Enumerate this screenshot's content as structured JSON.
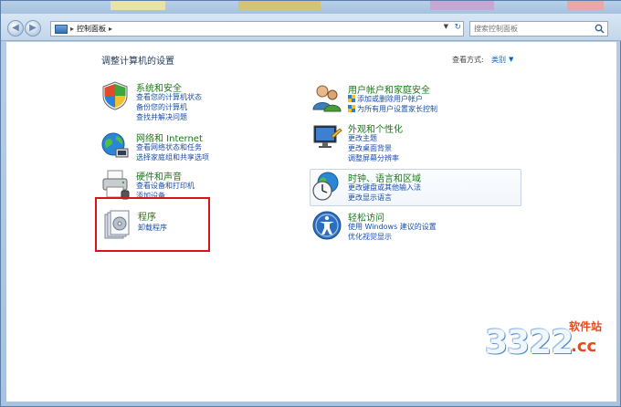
{
  "window": {
    "address": {
      "crumb": "控制面板"
    },
    "search": {
      "placeholder": "搜索控制面板"
    }
  },
  "page": {
    "title": "调整计算机的设置",
    "view_by_label": "查看方式:",
    "view_by_value": "类别"
  },
  "categories": [
    {
      "title": "系统和安全",
      "icon": "shield-icon",
      "links": [
        "查看您的计算机状态",
        "备份您的计算机",
        "查找并解决问题"
      ]
    },
    {
      "title": "网络和 Internet",
      "icon": "network-globe-icon",
      "links": [
        "查看网络状态和任务",
        "选择家庭组和共享选项"
      ]
    },
    {
      "title": "硬件和声音",
      "icon": "printer-icon",
      "links": [
        "查看设备和打印机",
        "添加设备"
      ]
    },
    {
      "title": "程序",
      "icon": "programs-icon",
      "links": [
        "卸载程序"
      ]
    },
    {
      "title": "用户帐户和家庭安全",
      "icon": "users-icon",
      "links": [
        "添加或删除用户帐户",
        "为所有用户设置家长控制"
      ]
    },
    {
      "title": "外观和个性化",
      "icon": "display-icon",
      "links": [
        "更改主题",
        "更改桌面背景",
        "调整屏幕分辨率"
      ]
    },
    {
      "title": "时钟、语言和区域",
      "icon": "clock-globe-icon",
      "links": [
        "更改键盘或其他输入法",
        "更改显示语言"
      ]
    },
    {
      "title": "轻松访问",
      "icon": "accessibility-icon",
      "links": [
        "使用 Windows 建议的设置",
        "优化视觉显示"
      ]
    }
  ],
  "watermark": {
    "number": "3322",
    "site": "软件站",
    "tld": ".cc"
  },
  "colors": {
    "category_title": "#1a7a1a",
    "link": "#1a4fa8",
    "highlight_border": "#d7141a"
  }
}
